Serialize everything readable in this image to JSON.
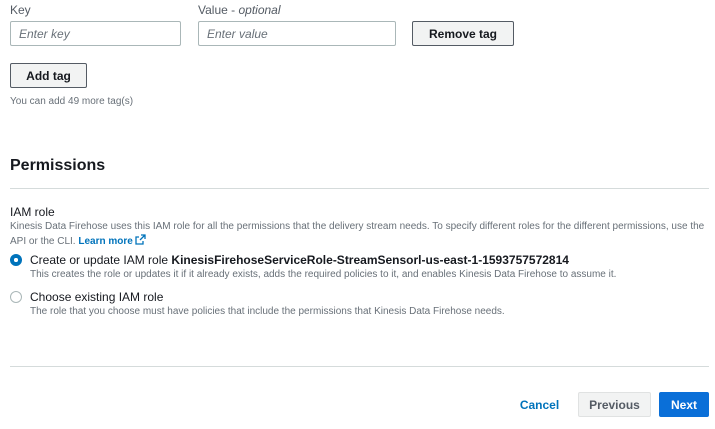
{
  "tags": {
    "key_label": "Key",
    "value_label": "Value - ",
    "value_label_optional": "optional",
    "key_placeholder": "Enter key",
    "value_placeholder": "Enter value",
    "remove_tag_label": "Remove tag",
    "add_tag_label": "Add tag",
    "remaining_hint": "You can add 49 more tag(s)"
  },
  "permissions": {
    "title": "Permissions",
    "iam_role_label": "IAM role",
    "description": "Kinesis Data Firehose uses this IAM role for all the permissions that the delivery stream needs. To specify different roles for the different permissions, use the API or the CLI.",
    "learn_more": "Learn more",
    "options": [
      {
        "label_prefix": "Create or update IAM role ",
        "label_bold": "KinesisFirehoseServiceRole-StreamSensorl-us-east-1-1593757572814",
        "description": "This creates the role or updates it if it already exists, adds the required policies to it, and enables Kinesis Data Firehose to assume it.",
        "selected": true
      },
      {
        "label_prefix": "Choose existing IAM role",
        "label_bold": "",
        "description": "The role that you choose must have policies that include the permissions that Kinesis Data Firehose needs.",
        "selected": false
      }
    ]
  },
  "footer": {
    "cancel_label": "Cancel",
    "previous_label": "Previous",
    "next_label": "Next"
  },
  "colors": {
    "accent": "#0073bb",
    "primary_button": "#0a6fd8",
    "divider": "#d5dbdb"
  },
  "icons": {
    "external_link": "external-link-icon"
  }
}
